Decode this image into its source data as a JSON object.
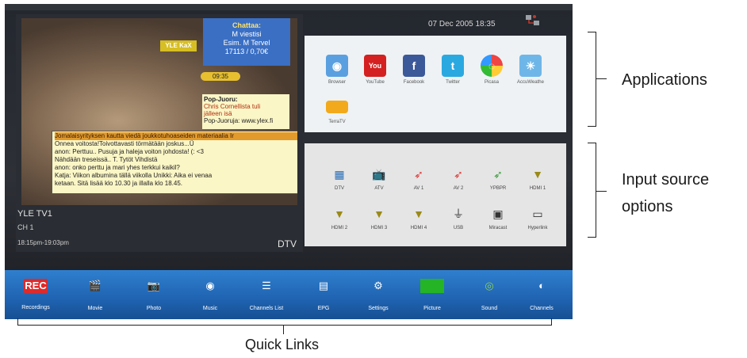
{
  "header": {
    "datetime": "07 Dec 2005 18:35",
    "network_icon": "network-icon"
  },
  "preview": {
    "video": {
      "badge": "YLE KaX",
      "chatbox_title": "Chattaa:",
      "chatbox_lines": [
        "M viestisi",
        "Esim. M Tervel",
        "17113 / 0,70€"
      ],
      "time": "09:35",
      "pop_title": "Pop-Juoru:",
      "pop_lines": [
        "Chris Cornellista tuli",
        "jälleen isä",
        "Pop-Juoruja: www.ylex.fi"
      ],
      "chat_lines": [
        "Jomalaisyrityksen kautta viedä joukkotuhoaseiden materiaalia Ir",
        "Onnea voitosta!Toivottavasti törmätään joskus...Ü",
        "anon: Perttuu.. Pusuja ja haleja voiton johdosta! (: <3",
        "Nähdään treseissä.. T. Tytöt Vihdistä",
        "anon: onko perttu ja mari yhes terkkui kaikil?",
        "Katja: Viikon albumina tällä viikolla Unikki: Aika ei venaa",
        "ketaan. Sitä lisää klo 10.30 ja illalla klo 18.45."
      ]
    },
    "channel_name": "YLE TV1",
    "channel_number": "CH 1",
    "time_range": "18:15pm-19:03pm",
    "source_type": "DTV"
  },
  "applications": [
    {
      "label": "Browser",
      "icon": "browser-icon",
      "color": "#5aa0e0"
    },
    {
      "label": "YouTube",
      "icon": "youtube-icon",
      "color": "#d42020"
    },
    {
      "label": "Facebook",
      "icon": "facebook-icon",
      "color": "#3b5998"
    },
    {
      "label": "Twitter",
      "icon": "twitter-icon",
      "color": "#2aa9e0"
    },
    {
      "label": "Picasa",
      "icon": "picasa-icon",
      "color": "#ffffff"
    },
    {
      "label": "AccuWeathe",
      "icon": "weather-icon",
      "color": "#6fb6e8"
    },
    {
      "label": "TerraTV",
      "icon": "terratv-icon",
      "color": "#f2a91b"
    }
  ],
  "input_sources": [
    {
      "label": "DTV",
      "icon": "dtv-icon"
    },
    {
      "label": "ATV",
      "icon": "tv-icon"
    },
    {
      "label": "AV 1",
      "icon": "av-cable-icon"
    },
    {
      "label": "AV 2",
      "icon": "av-cable-icon"
    },
    {
      "label": "YPBPR",
      "icon": "ypbpr-cable-icon"
    },
    {
      "label": "HDMI 1",
      "icon": "hdmi-icon"
    },
    {
      "label": "HDMI 2",
      "icon": "hdmi-icon"
    },
    {
      "label": "HDMI 3",
      "icon": "hdmi-icon"
    },
    {
      "label": "HDMI 4",
      "icon": "hdmi-icon"
    },
    {
      "label": "USB",
      "icon": "usb-icon"
    },
    {
      "label": "Miracast",
      "icon": "miracast-icon"
    },
    {
      "label": "Hyperlink",
      "icon": "hyperlink-icon"
    }
  ],
  "quick_links": [
    {
      "label": "Recordings",
      "icon": "rec-icon",
      "text": "REC"
    },
    {
      "label": "Movie",
      "icon": "clapperboard-icon"
    },
    {
      "label": "Photo",
      "icon": "camera-icon"
    },
    {
      "label": "Music",
      "icon": "music-disc-icon"
    },
    {
      "label": "Channels List",
      "icon": "channels-list-icon"
    },
    {
      "label": "EPG",
      "icon": "epg-icon"
    },
    {
      "label": "Settings",
      "icon": "gear-icon"
    },
    {
      "label": "Picture",
      "icon": "monitor-icon"
    },
    {
      "label": "Sound",
      "icon": "speaker-icon"
    },
    {
      "label": "Channels",
      "icon": "satellite-dish-icon"
    }
  ],
  "annotations": {
    "applications": "Applications",
    "input_source_line1": "Input source",
    "input_source_line2": "options",
    "quick_links": "Quick Links"
  }
}
